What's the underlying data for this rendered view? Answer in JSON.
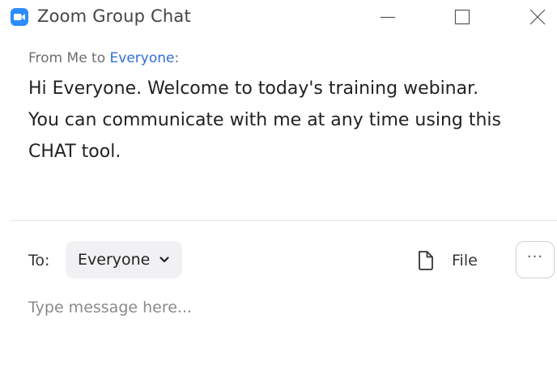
{
  "window": {
    "title": "Zoom Group Chat",
    "app_icon": "zoom-camera-icon",
    "controls": [
      "minimize-icon",
      "maximize-icon",
      "close-icon"
    ]
  },
  "message": {
    "from_prefix": "From Me to ",
    "recipient": "Everyone",
    "suffix": ":",
    "text": "Hi Everyone. Welcome to today's training webinar. You can communicate with me at any time using this CHAT tool."
  },
  "compose": {
    "to_label": "To:",
    "recipient_selected": "Everyone",
    "file_label": "File",
    "file_icon": "file-icon",
    "more_label": "···",
    "input_value": "",
    "input_placeholder": "Type message here..."
  },
  "colors": {
    "accent": "#2d8cff",
    "recipient_link": "#2d6fdb",
    "divider": "#e6e6e6",
    "select_bg": "#f1f1f4"
  }
}
